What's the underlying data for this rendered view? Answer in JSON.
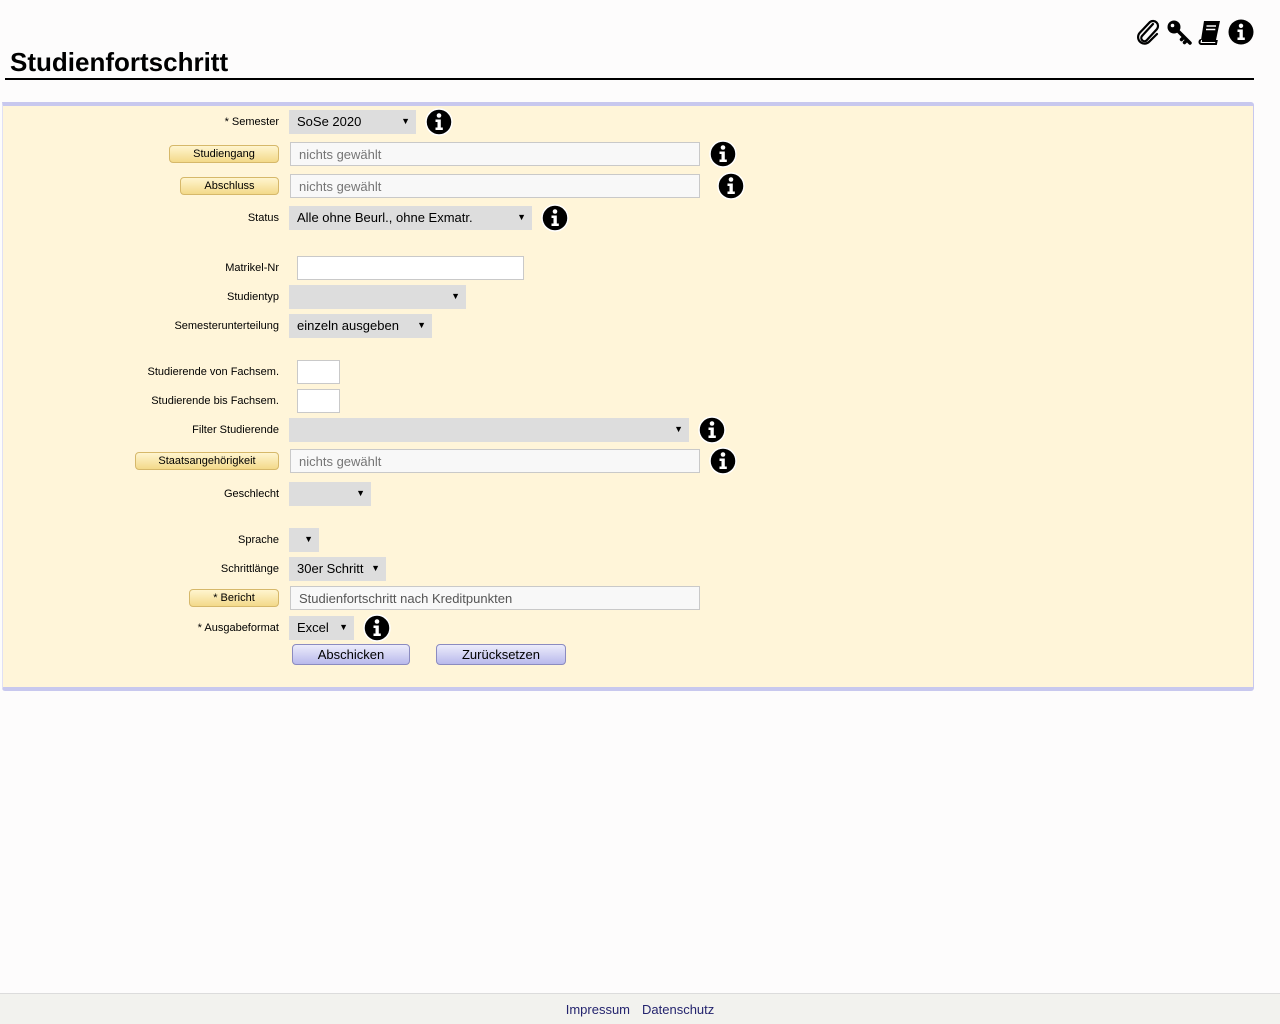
{
  "header": {
    "title": "Studienfortschritt",
    "icons": [
      "paperclip-icon",
      "key-icon",
      "book-icon",
      "info-icon"
    ]
  },
  "form": {
    "semester": {
      "label": "* Semester",
      "value": "SoSe 2020"
    },
    "studiengang": {
      "button": "Studiengang",
      "placeholder": "nichts gewählt"
    },
    "abschluss": {
      "button": "Abschluss",
      "placeholder": "nichts gewählt"
    },
    "status": {
      "label": "Status",
      "value": "Alle ohne Beurl., ohne Exmatr."
    },
    "matrikel": {
      "label": "Matrikel-Nr",
      "value": ""
    },
    "studientyp": {
      "label": "Studientyp",
      "value": ""
    },
    "semesterunterteilung": {
      "label": "Semesterunterteilung",
      "value": "einzeln ausgeben"
    },
    "von_fachsem": {
      "label": "Studierende von Fachsem.",
      "value": ""
    },
    "bis_fachsem": {
      "label": "Studierende bis Fachsem.",
      "value": ""
    },
    "filter_studierende": {
      "label": "Filter Studierende",
      "value": ""
    },
    "staatsangehoerigkeit": {
      "button": "Staatsangehörigkeit",
      "placeholder": "nichts gewählt"
    },
    "geschlecht": {
      "label": "Geschlecht",
      "value": ""
    },
    "sprache": {
      "label": "Sprache",
      "value": ""
    },
    "schrittlaenge": {
      "label": "Schrittlänge",
      "value": "30er Schritt"
    },
    "bericht": {
      "button": "* Bericht",
      "value": "Studienfortschritt nach Kreditpunkten"
    },
    "ausgabeformat": {
      "label": "* Ausgabeformat",
      "value": "Excel"
    },
    "submit_label": "Abschicken",
    "reset_label": "Zurücksetzen"
  },
  "footer": {
    "impressum": "Impressum",
    "datenschutz": "Datenschutz"
  },
  "colors": {
    "panel_bg": "#fff5d9",
    "panel_border": "#c8c8ee",
    "select_bg": "#dddddd",
    "link": "#24246e"
  }
}
